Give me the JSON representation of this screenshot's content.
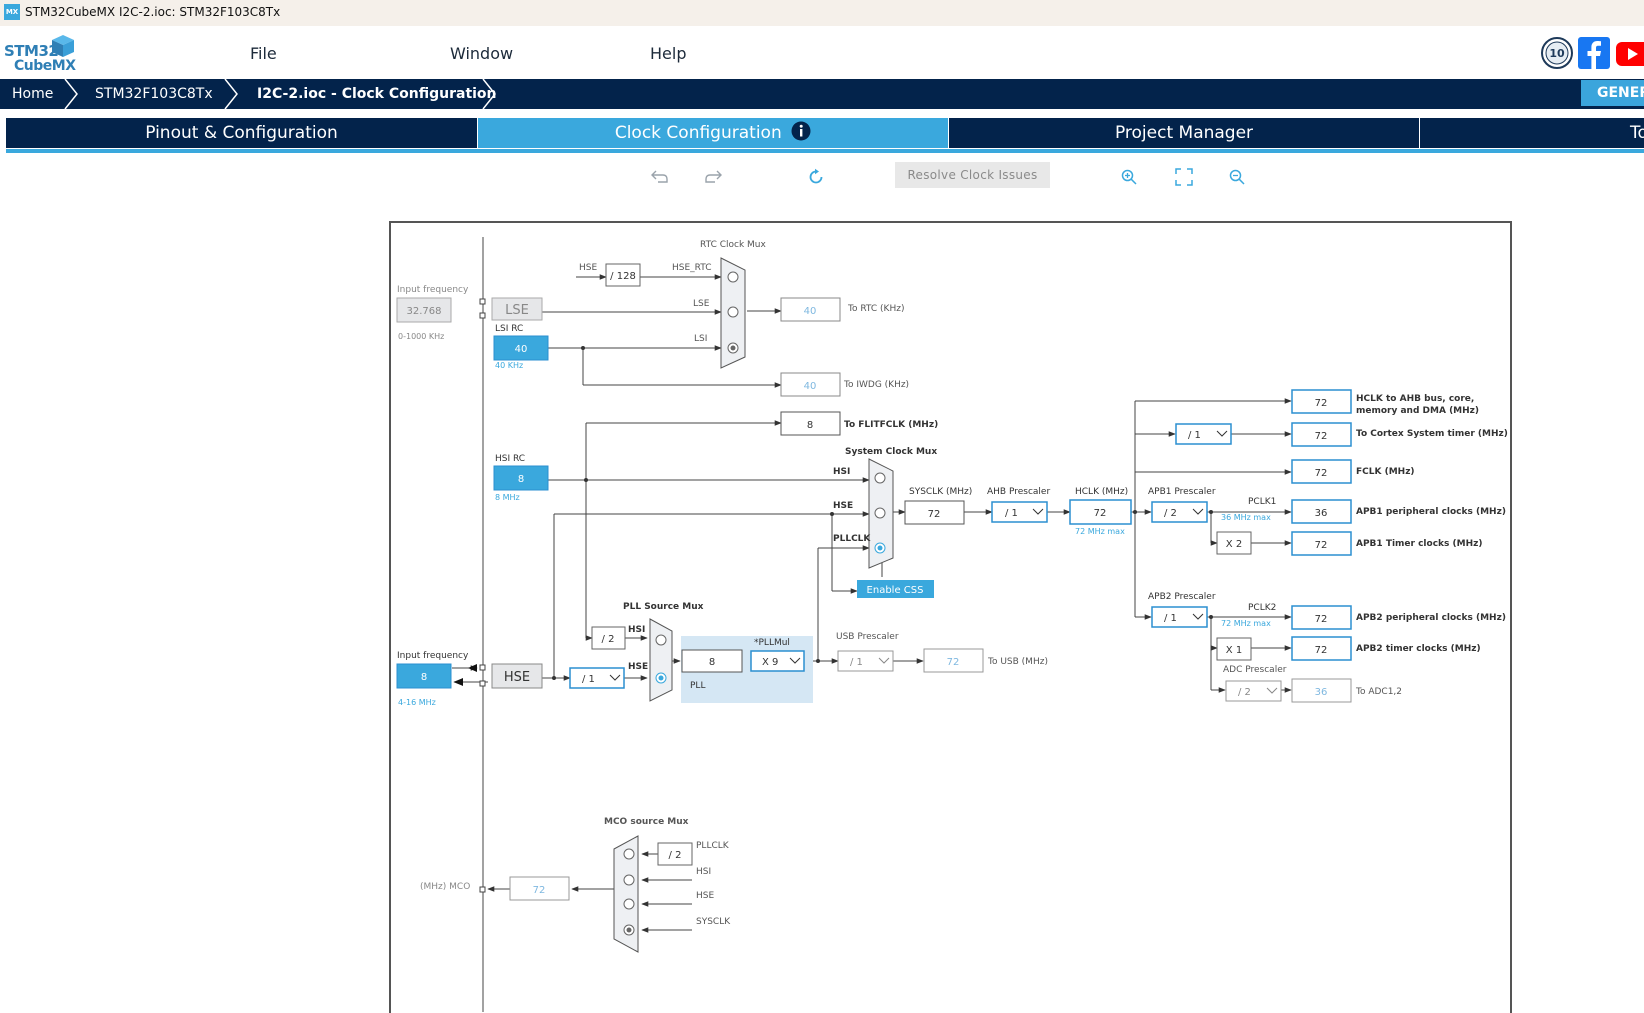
{
  "window": {
    "title": "STM32CubeMX I2C-2.ioc: STM32F103C8Tx",
    "icon": "MX"
  },
  "logo": {
    "line1": "STM32",
    "line2": "CubeMX"
  },
  "menu": [
    "File",
    "Window",
    "Help"
  ],
  "breadcrumb": [
    "Home",
    "STM32F103C8Tx",
    "I2C-2.ioc - Clock Configuration"
  ],
  "generate_label": "GENER",
  "tabs": [
    "Pinout & Configuration",
    "Clock Configuration",
    "Project Manager",
    "To"
  ],
  "toolbar": {
    "resolve": "Resolve Clock Issues"
  },
  "colors": {
    "navy": "#03234b",
    "accent": "#3aa8dd",
    "box_border": "#2b8fd0"
  },
  "diagram": {
    "rtc_mux_title": "RTC Clock Mux",
    "hse_label": "HSE",
    "div128": "/ 128",
    "hse_rtc": "HSE_RTC",
    "lse_line": "LSE",
    "lsi_line": "LSI",
    "input_freq_label": "Input frequency",
    "lse_input": "32.768",
    "lse_range": "0-1000 KHz",
    "lse_box": "LSE",
    "lsi_rc_label": "LSI RC",
    "lsi_value": "40",
    "lsi_unit": "40 KHz",
    "rtc_value": "40",
    "rtc_label": "To RTC (KHz)",
    "iwdg_value": "40",
    "iwdg_label": "To IWDG (KHz)",
    "flit_value": "8",
    "flit_label": "To FLITFCLK (MHz)",
    "sysmux_title": "System Clock Mux",
    "hsi_rc_label": "HSI RC",
    "hsi_value": "8",
    "hsi_unit": "8 MHz",
    "mux_hsi": "HSI",
    "mux_hse": "HSE",
    "mux_pllclk": "PLLCLK",
    "sysclk_label": "SYSCLK (MHz)",
    "sysclk_value": "72",
    "ahb_label": "AHB Prescaler",
    "ahb_value": "/ 1",
    "hclk_label": "HCLK (MHz)",
    "hclk_value": "72",
    "hclk_max": "72 MHz max",
    "enable_css": "Enable CSS",
    "apb1_label": "APB1 Prescaler",
    "apb1_value": "/ 2",
    "pclk1": "PCLK1",
    "pclk1_max": "36 MHz max",
    "x2": "X 2",
    "cortex_div": "/ 1",
    "apb2_label": "APB2 Prescaler",
    "apb2_value": "/ 1",
    "pclk2": "PCLK2",
    "pclk2_max": "72 MHz max",
    "x1": "X 1",
    "adc_label": "ADC Prescaler",
    "adc_value": "/ 2",
    "outputs": [
      {
        "value": "72",
        "label": "HCLK to AHB bus, core,",
        "label2": "memory and DMA (MHz)"
      },
      {
        "value": "72",
        "label": "To Cortex System timer (MHz)"
      },
      {
        "value": "72",
        "label": "FCLK (MHz)"
      },
      {
        "value": "36",
        "label": "APB1 peripheral clocks (MHz)"
      },
      {
        "value": "72",
        "label": "APB1 Timer clocks (MHz)"
      },
      {
        "value": "72",
        "label": "APB2 peripheral clocks (MHz)"
      },
      {
        "value": "72",
        "label": "APB2 timer clocks (MHz)"
      },
      {
        "value": "36",
        "label": "To ADC1,2"
      }
    ],
    "pll_src_title": "PLL Source Mux",
    "pll_div2": "/ 2",
    "pll_hsi": "HSI",
    "pll_hse": "HSE",
    "hse_input_label": "Input frequency",
    "hse_input": "8",
    "hse_range": "4-16 MHz",
    "hse_box": "HSE",
    "hse_div": "/ 1",
    "pll_input": "8",
    "pllmul_label": "*PLLMul",
    "pllmul_value": "X 9",
    "pll_label": "PLL",
    "usb_label": "USB Prescaler",
    "usb_div": "/ 1",
    "usb_value": "72",
    "usb_out": "To USB (MHz)",
    "mco_title": "MCO source Mux",
    "mco_div": "/ 2",
    "mco_pllclk": "PLLCLK",
    "mco_hsi": "HSI",
    "mco_hse": "HSE",
    "mco_sysclk": "SYSCLK",
    "mco_label": "(MHz) MCO",
    "mco_value": "72"
  }
}
